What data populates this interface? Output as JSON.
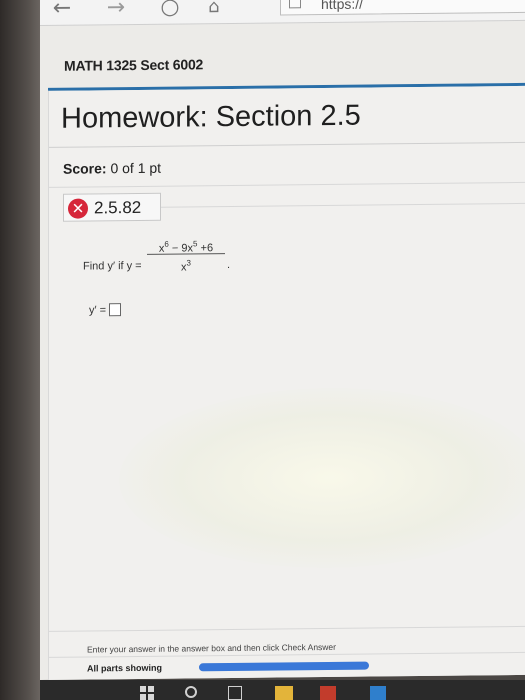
{
  "browser": {
    "back_glyph": "←",
    "forward_glyph": "→",
    "refresh_glyph": "○",
    "home_glyph": "⌂",
    "url_text": "https://"
  },
  "course": {
    "title": "MATH 1325 Sect 6002"
  },
  "homework": {
    "title": "Homework: Section 2.5",
    "score_label": "Score:",
    "score_value": "0 of 1 pt",
    "question_id": "2.5.82",
    "question_status_icon": "x-icon"
  },
  "question": {
    "prompt": "Find y′ if y =",
    "numerator_a": "x",
    "numerator_a_exp": "6",
    "numerator_b": " − 9x",
    "numerator_b_exp": "5",
    "numerator_c": " +6",
    "denominator": "x",
    "denominator_exp": "3",
    "trailing": ".",
    "answer_label": "y′ ="
  },
  "footer": {
    "instruction": "Enter your answer in the answer box and then click Check Answer",
    "parts_label": "All parts showing",
    "progress_fraction": 1.0
  },
  "colors": {
    "accent": "#2a6fa8",
    "error": "#d6263a",
    "progress": "#3a78d8"
  }
}
